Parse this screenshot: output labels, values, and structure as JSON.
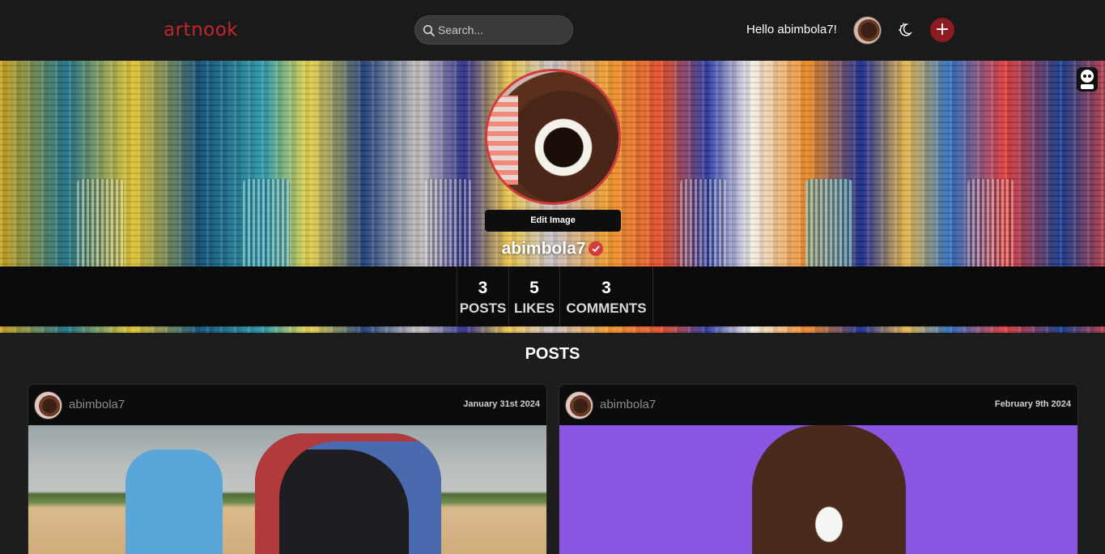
{
  "header": {
    "logo": "artnook",
    "search_placeholder": "Search...",
    "greeting": "Hello abimbola7!",
    "add_label": "+"
  },
  "profile": {
    "edit_image_label": "Edit Image",
    "username": "abimbola7",
    "stats": [
      {
        "value": "3",
        "label": "POSTS"
      },
      {
        "value": "5",
        "label": "LIKES"
      },
      {
        "value": "3",
        "label": "COMMENTS"
      }
    ]
  },
  "posts": {
    "title": "POSTS",
    "items": [
      {
        "user": "abimbola7",
        "date": "January 31st 2024"
      },
      {
        "user": "abimbola7",
        "date": "February 9th 2024"
      }
    ]
  },
  "colors": {
    "accent": "#c0272d",
    "background": "#1c1c1c",
    "verified": "#d43b3b"
  }
}
